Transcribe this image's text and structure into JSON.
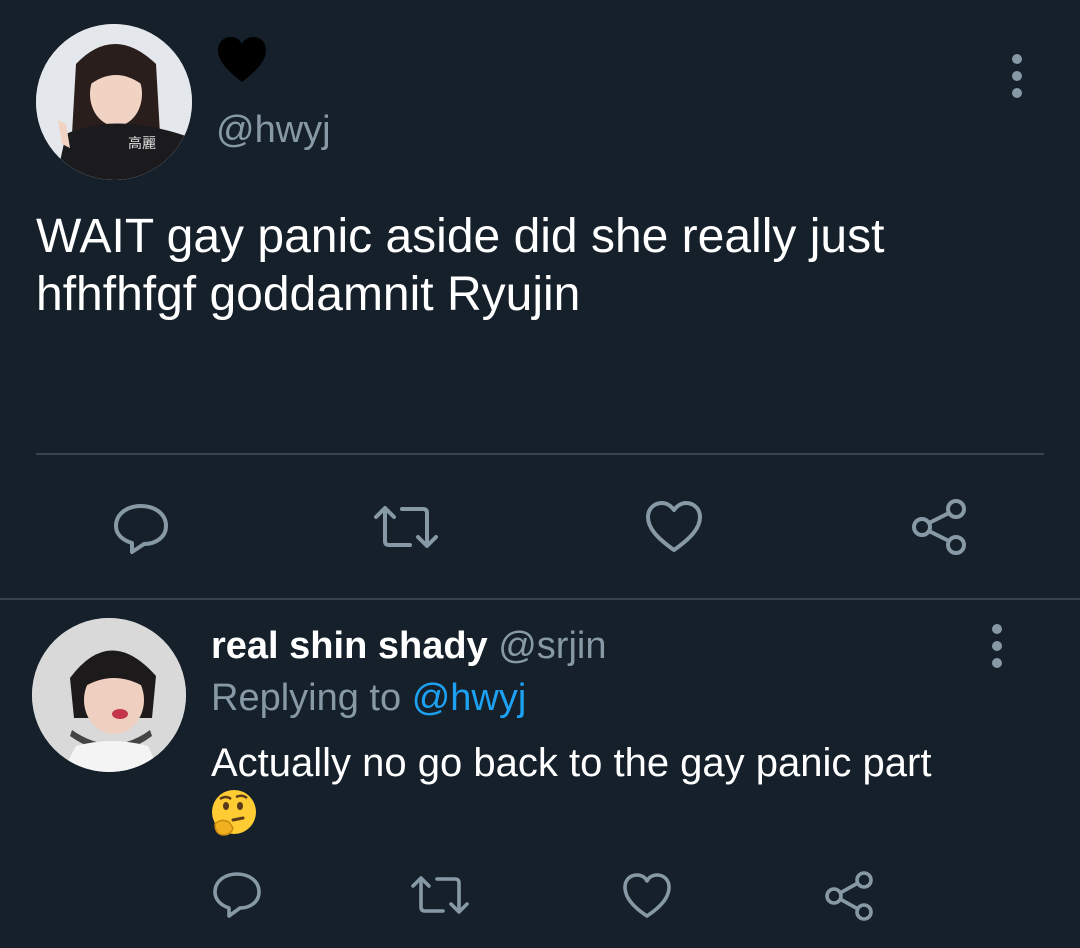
{
  "tweet": {
    "display_name_emoji": "black-heart-icon",
    "handle": "@hwyj",
    "text": "WAIT gay panic aside did she really just hfhfhfgf goddamnit Ryujin",
    "actions": [
      "reply-icon",
      "retweet-icon",
      "like-icon",
      "share-icon"
    ]
  },
  "reply": {
    "display_name": "real shin shady",
    "handle": "@srjin",
    "replying_prefix": "Replying to",
    "replying_mention": "@hwyj",
    "text": "Actually no go back to the gay panic part",
    "emoji": "thinking-face-icon",
    "actions": [
      "reply-icon",
      "retweet-icon",
      "like-icon",
      "share-icon"
    ]
  },
  "colors": {
    "background": "#15202b",
    "secondary_text": "#8899a6",
    "link": "#1da1f2",
    "divider": "#38444d"
  }
}
